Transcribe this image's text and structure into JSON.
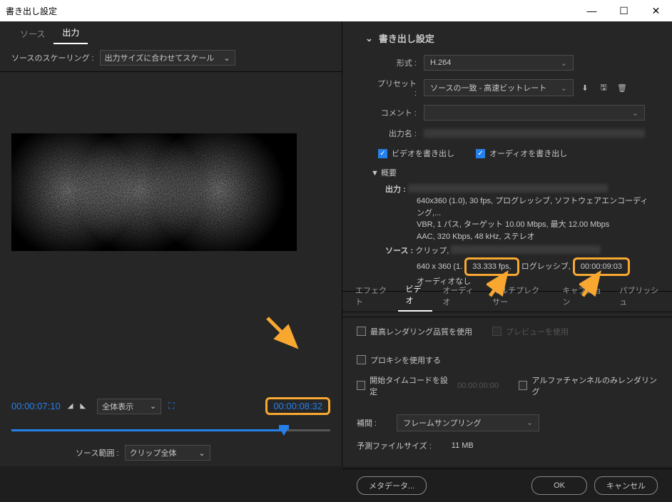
{
  "window": {
    "title": "書き出し設定"
  },
  "leftTabs": {
    "source": "ソース",
    "output": "出力"
  },
  "scaling": {
    "label": "ソースのスケーリング :",
    "value": "出力サイズに合わせてスケール"
  },
  "timecode": {
    "in": "00:00:07:10",
    "out": "00:00:08:32"
  },
  "viewMode": "全体表示",
  "sourceRange": {
    "label": "ソース範囲 :",
    "value": "クリップ全体"
  },
  "section": {
    "title": "書き出し設定"
  },
  "form": {
    "formatLabel": "形式 :",
    "formatValue": "H.264",
    "presetLabel": "プリセット :",
    "presetValue": "ソースの一致 - 高速ビットレート",
    "commentLabel": "コメント :",
    "commentValue": "",
    "outputNameLabel": "出力名 :"
  },
  "checkboxes": {
    "video": "ビデオを書き出し",
    "audio": "オーディオを書き出し"
  },
  "summaryTitle": "▼ 概要",
  "summary": {
    "outputLabel": "出力 :",
    "outputLine1": "640x360 (1.0), 30 fps, プログレッシブ, ソフトウェアエンコーディング,...",
    "outputLine2": "VBR, 1 パス, ターゲット 10.00 Mbps, 最大 12.00 Mbps",
    "outputLine3": "AAC, 320 Kbps, 48 kHz, ステレオ",
    "sourceLabel": "ソース :",
    "sourcePrefix": "クリップ, ",
    "sourceLine1a": "640 x 360 (1.",
    "sourceFps": "33.333 fps,",
    "sourceProg": "ログレッシブ",
    "sourceDur": "00:00:09:03",
    "sourceLine2": "オーディオなし"
  },
  "subTabs": {
    "effect": "エフェクト",
    "video": "ビデオ",
    "audio": "オーディオ",
    "mux": "マルチプレクサー",
    "caption": "キャプション",
    "publish": "パブリッシュ"
  },
  "settings": {
    "maxRender": "最高レンダリング品質を使用",
    "usePreview": "プレビューを使用",
    "useProxy": "プロキシを使用する",
    "startTC": "開始タイムコードを設定",
    "startTCValue": "00:00:00:00",
    "alphaOnly": "アルファチャンネルのみレンダリング",
    "interpLabel": "補間 :",
    "interpValue": "フレームサンプリング",
    "estSizeLabel": "予測ファイルサイズ :",
    "estSizeValue": "11 MB"
  },
  "footer": {
    "metadata": "メタデータ...",
    "ok": "OK",
    "cancel": "キャンセル"
  }
}
